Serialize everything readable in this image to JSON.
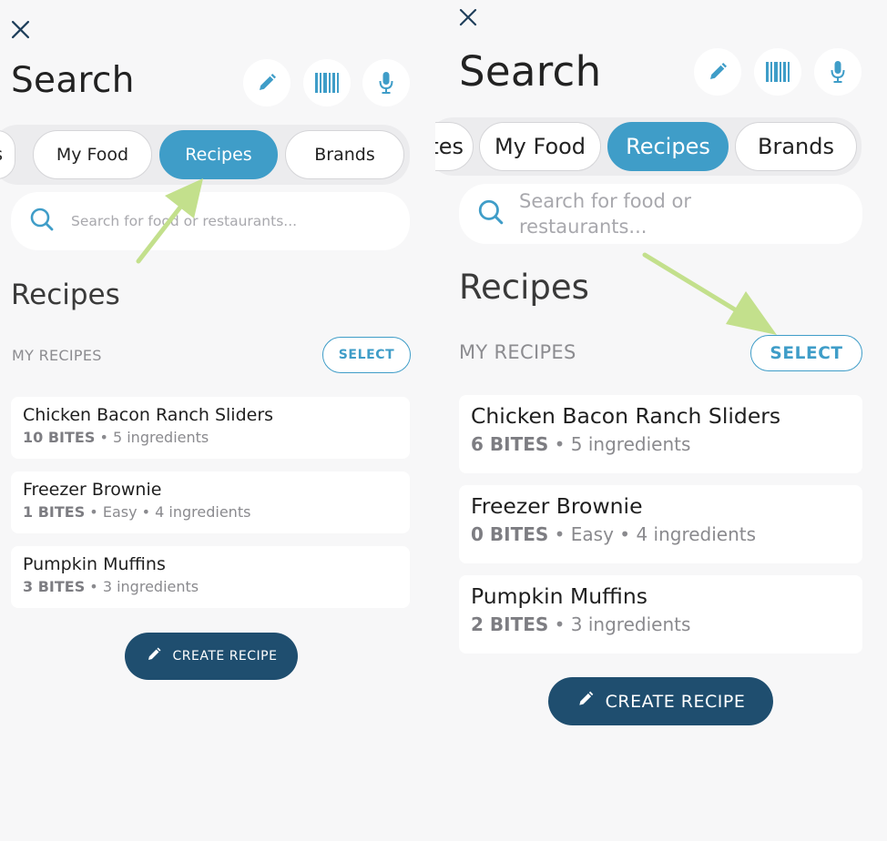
{
  "colors": {
    "accent": "#3f9dc8",
    "dark_button": "#1f4e6f",
    "annotation_arrow": "#c3e08c",
    "background": "#f7f7f8"
  },
  "icons": [
    "close-icon",
    "pencil-icon",
    "barcode-icon",
    "microphone-icon",
    "search-icon"
  ],
  "left": {
    "title": "Search",
    "tabs": [
      {
        "label": "s",
        "active": false
      },
      {
        "label": "My Food",
        "active": false
      },
      {
        "label": "Recipes",
        "active": true
      },
      {
        "label": "Brands",
        "active": false
      }
    ],
    "search_placeholder": "Search for food or restaurants...",
    "section_title": "Recipes",
    "section_subtitle": "MY RECIPES",
    "select_label": "SELECT",
    "recipes": [
      {
        "name": "Chicken Bacon Ranch Sliders",
        "bites": "10 BITES",
        "details": " • 5 ingredients"
      },
      {
        "name": "Freezer Brownie",
        "bites": "1 BITES",
        "details": " • Easy • 4 ingredients"
      },
      {
        "name": "Pumpkin Muffins",
        "bites": "3 BITES",
        "details": " • 3 ingredients"
      }
    ],
    "create_label": "CREATE RECIPE"
  },
  "right": {
    "title": "Search",
    "tabs": [
      {
        "label": "tes",
        "active": false
      },
      {
        "label": "My Food",
        "active": false
      },
      {
        "label": "Recipes",
        "active": true
      },
      {
        "label": "Brands",
        "active": false
      }
    ],
    "search_placeholder_line1": "Search for food or",
    "search_placeholder_line2": "restaurants...",
    "section_title": "Recipes",
    "section_subtitle": "MY RECIPES",
    "select_label": "SELECT",
    "recipes": [
      {
        "name": "Chicken Bacon Ranch Sliders",
        "bites": "6 BITES",
        "details": " • 5 ingredients"
      },
      {
        "name": "Freezer Brownie",
        "bites": "0 BITES",
        "details": " • Easy • 4 ingredients"
      },
      {
        "name": "Pumpkin Muffins",
        "bites": "2 BITES",
        "details": " • 3 ingredients"
      }
    ],
    "create_label": "CREATE RECIPE"
  }
}
